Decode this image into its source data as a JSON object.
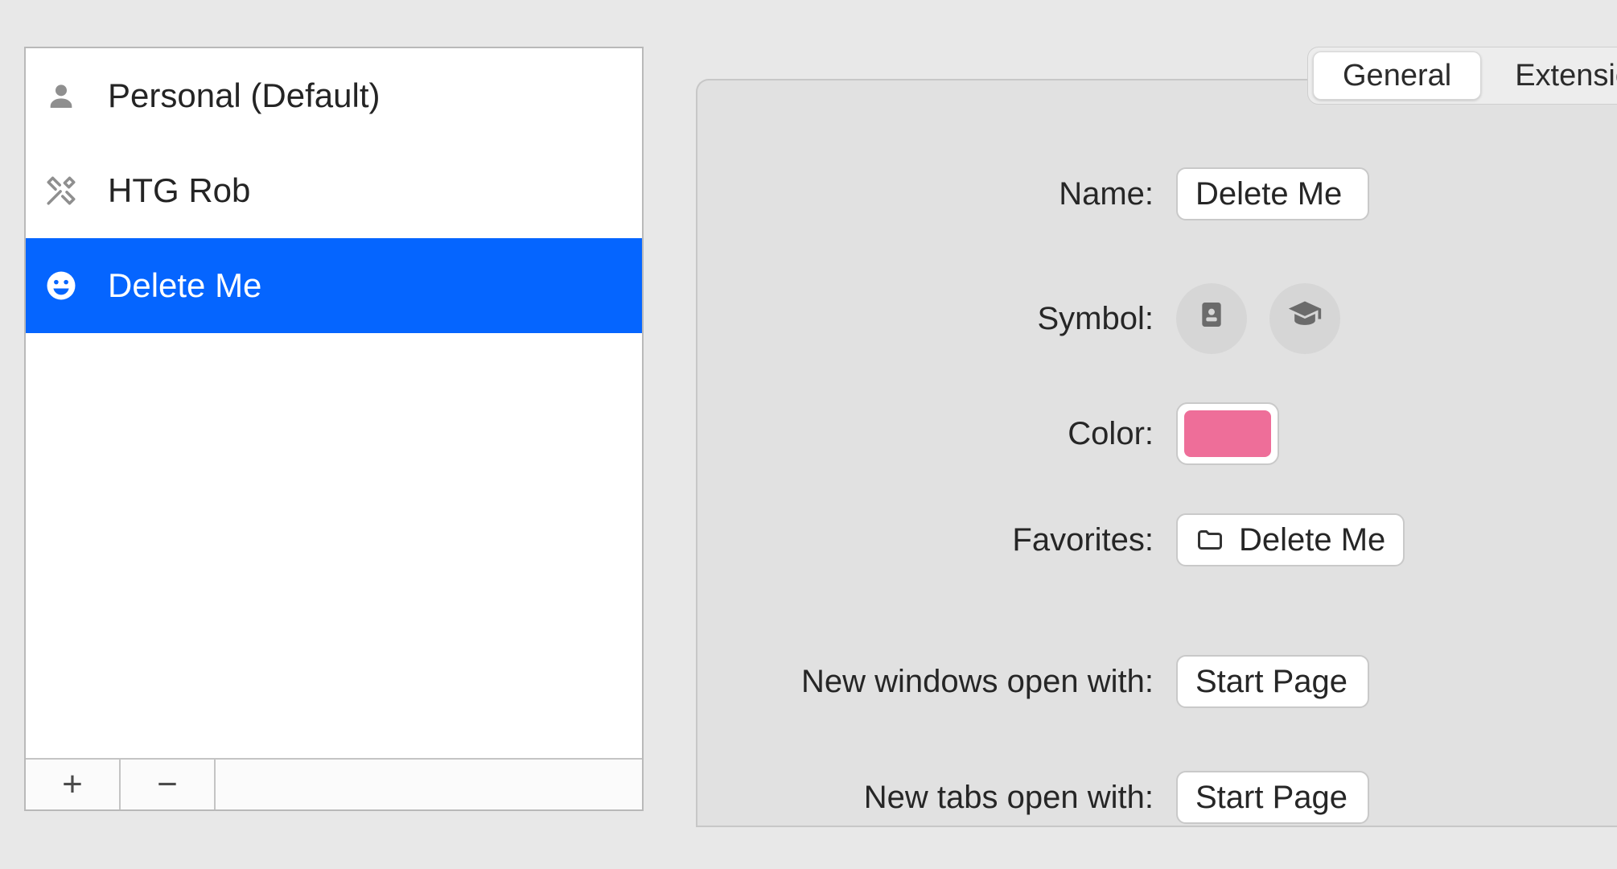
{
  "sidebar": {
    "profiles": [
      {
        "label": "Personal (Default)",
        "icon": "person",
        "selected": false
      },
      {
        "label": "HTG Rob",
        "icon": "tools",
        "selected": false
      },
      {
        "label": "Delete Me",
        "icon": "smiley",
        "selected": true
      }
    ],
    "add_label": "+",
    "remove_label": "−"
  },
  "tabs": {
    "items": [
      {
        "label": "General",
        "active": true
      },
      {
        "label": "Extensions",
        "active": false
      }
    ]
  },
  "form": {
    "name_label": "Name:",
    "name_value": "Delete Me",
    "symbol_label": "Symbol:",
    "symbols": [
      {
        "name": "id-card-icon"
      },
      {
        "name": "graduation-cap-icon"
      }
    ],
    "color_label": "Color:",
    "color_value": "#ee6e99",
    "favorites_label": "Favorites:",
    "favorites_value": "Delete Me",
    "new_windows_label": "New windows open with:",
    "new_windows_value": "Start Page",
    "new_tabs_label": "New tabs open with:",
    "new_tabs_value": "Start Page"
  }
}
